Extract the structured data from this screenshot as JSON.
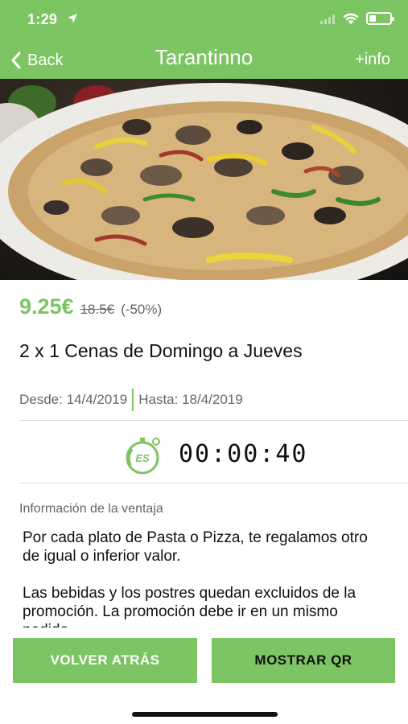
{
  "status_bar": {
    "time": "1:29"
  },
  "nav": {
    "back_label": "Back",
    "title": "Tarantinno",
    "info_label": "+info"
  },
  "hero": {
    "alt": "Pizza"
  },
  "offer": {
    "price": "9.25€",
    "old_price": "18.5€",
    "discount": "(-50%)",
    "title": "2 x 1 Cenas de Domingo a Jueves",
    "from": "Desde: 14/4/2019",
    "to": "Hasta: 18/4/2019"
  },
  "timer": {
    "value": "00:00:40",
    "icon_text": "ES"
  },
  "details": {
    "label": "Información de la ventaja",
    "paragraphs": [
      "Por cada plato de Pasta o Pizza, te regalamos otro de igual o inferior valor.",
      "Las bebidas y los postres quedan excluidos de la promoción. La promoción debe ir en un mismo pedido."
    ]
  },
  "buttons": {
    "back": "VOLVER ATRÁS",
    "qr": "MOSTRAR QR"
  },
  "colors": {
    "accent": "#7dc462",
    "text": "#111111",
    "muted": "#666666"
  }
}
